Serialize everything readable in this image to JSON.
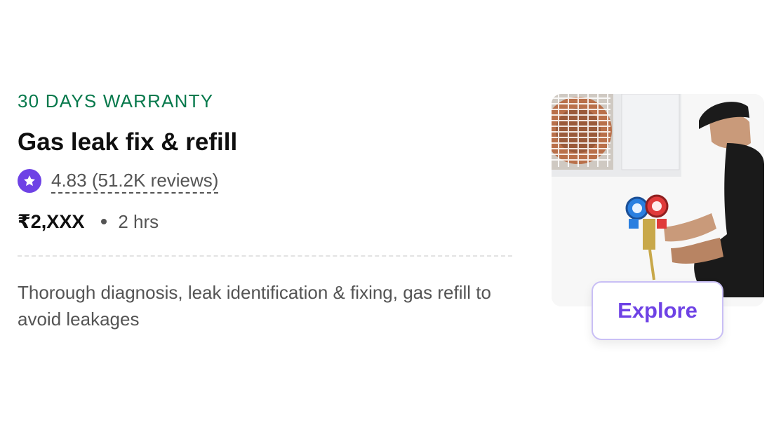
{
  "service": {
    "tag": "30 DAYS WARRANTY",
    "title": "Gas leak fix & refill",
    "rating": "4.83 (51.2K reviews)",
    "price": "₹2,XXX",
    "duration": "2 hrs",
    "description": "Thorough diagnosis, leak identification & fixing, gas refill to avoid leakages",
    "cta_label": "Explore",
    "icons": {
      "rating": "star-icon"
    }
  },
  "colors": {
    "tag": "#07794c",
    "accent": "#6e42e5",
    "text_primary": "#0f0f0f",
    "text_secondary": "#545454"
  }
}
